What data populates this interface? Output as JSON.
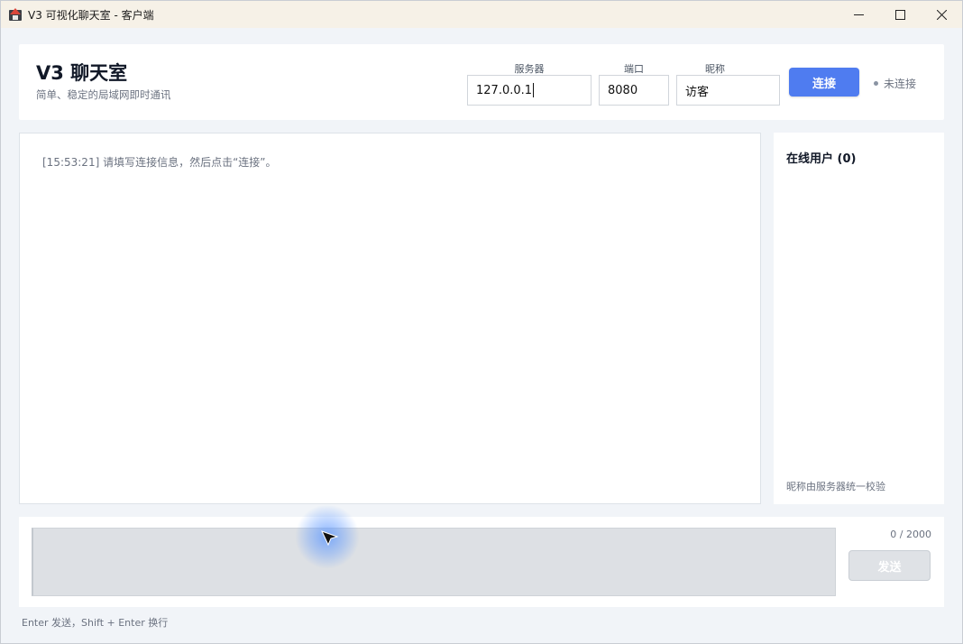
{
  "window": {
    "title": "V3 可视化聊天室 - 客户端",
    "icon": "app-logo-icon",
    "controls": [
      "minimize-icon",
      "maximize-icon",
      "close-icon"
    ]
  },
  "header": {
    "title": "V3 聊天室",
    "subtitle": "简单、稳定的局域网即时通讯",
    "server": {
      "label": "服务器",
      "value": "127.0.0.1"
    },
    "port": {
      "label": "端口",
      "value": "8080"
    },
    "nickname": {
      "label": "昵称",
      "value": "访客"
    },
    "connect_label": "连接",
    "status_text": "未连接",
    "accent": "#4f7cf0"
  },
  "chat_log": {
    "lines": [
      {
        "time": "[15:53:21]",
        "text": "请填写连接信息，然后点击“连接”。"
      }
    ]
  },
  "users": {
    "title": "在线用户 (0)",
    "note": "昵称由服务器统一校验"
  },
  "composer": {
    "char_count": "0 / 2000",
    "send_label": "发送",
    "hint": "Enter 发送，Shift + Enter 换行"
  }
}
